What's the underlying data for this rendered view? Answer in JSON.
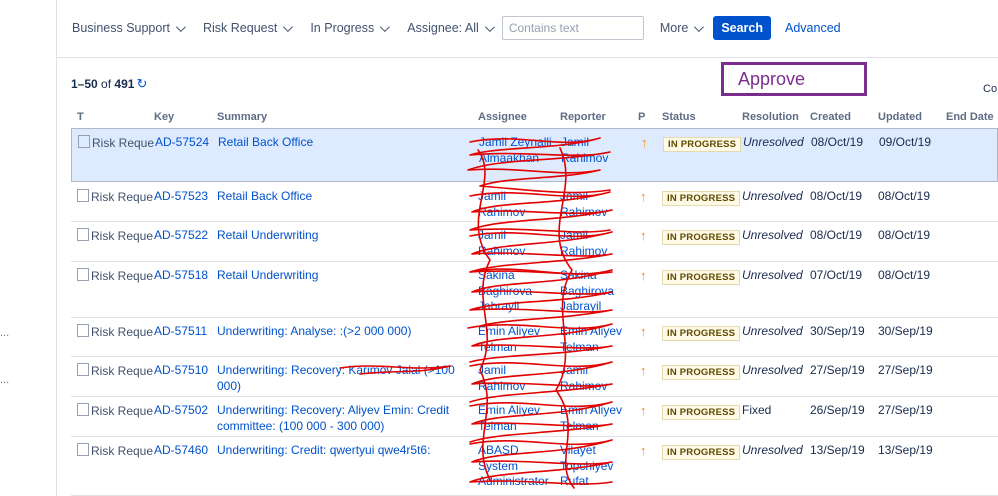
{
  "filters": {
    "project": "Business Support",
    "type": "Risk Request",
    "status": "In Progress",
    "assignee": "Assignee: All",
    "text_placeholder": "Contains text",
    "more": "More",
    "search": "Search",
    "advanced": "Advanced"
  },
  "results": {
    "range": "1–50",
    "of": "of",
    "total": "491"
  },
  "annotation": {
    "approve": "Approve"
  },
  "cut_text": "Co",
  "rail": {
    "dots1": "...",
    "dots2": "..."
  },
  "columns": [
    "T",
    "Key",
    "Summary",
    "Assignee",
    "Reporter",
    "P",
    "Status",
    "Resolution",
    "Created",
    "Updated",
    "End Date"
  ],
  "rows": [
    {
      "type_alt": "Risk Reque",
      "key": "AD-57524",
      "summary": "Retail Back Office",
      "assignee": "Jamil Zeynalli Almaakhan",
      "reporter": "Jamil Rahimov",
      "priority": "↑",
      "status": "IN PROGRESS",
      "resolution": "Unresolved",
      "created": "08/Oct/19",
      "updated": "09/Oct/19"
    },
    {
      "type_alt": "Risk Reque",
      "key": "AD-57523",
      "summary": "Retail Back Office",
      "assignee": "Jamil Rahimov",
      "reporter": "Jamil Rahimov",
      "priority": "↑",
      "status": "IN PROGRESS",
      "resolution": "Unresolved",
      "created": "08/Oct/19",
      "updated": "08/Oct/19"
    },
    {
      "type_alt": "Risk Reque",
      "key": "AD-57522",
      "summary": "Retail Underwriting",
      "assignee": "Jamil Rahimov",
      "reporter": "Jamil Rahimov",
      "priority": "↑",
      "status": "IN PROGRESS",
      "resolution": "Unresolved",
      "created": "08/Oct/19",
      "updated": "08/Oct/19"
    },
    {
      "type_alt": "Risk Reque",
      "key": "AD-57518",
      "summary": "Retail Underwriting",
      "assignee": "Sakina Baghirova Jabrayil",
      "reporter": "Sakina Baghirova Jabrayil",
      "priority": "↑",
      "status": "IN PROGRESS",
      "resolution": "Unresolved",
      "created": "07/Oct/19",
      "updated": "08/Oct/19"
    },
    {
      "type_alt": "Risk Reque",
      "key": "AD-57511",
      "summary": "Underwriting: Analyse: :(>2 000 000)",
      "assignee": "Emin Aliyev Telman",
      "reporter": "Emin Aliyev Telman",
      "priority": "↑",
      "status": "IN PROGRESS",
      "resolution": "Unresolved",
      "created": "30/Sep/19",
      "updated": "30/Sep/19"
    },
    {
      "type_alt": "Risk Reque",
      "key": "AD-57510",
      "summary": "Underwriting: Recovery: Karimov Jalal (>100 000)",
      "assignee": "Jamil Rahimov",
      "reporter": "Jamil Rahimov",
      "priority": "↑",
      "status": "IN PROGRESS",
      "resolution": "Unresolved",
      "created": "27/Sep/19",
      "updated": "27/Sep/19"
    },
    {
      "type_alt": "Risk Reque",
      "key": "AD-57502",
      "summary": "Underwriting: Recovery: Aliyev Emin: Credit committee: (100 000 - 300 000)",
      "assignee": "Emin Aliyev Telman",
      "reporter": "Emin Aliyev Telman",
      "priority": "↑",
      "status": "IN PROGRESS",
      "resolution": "Fixed",
      "created": "26/Sep/19",
      "updated": "27/Sep/19"
    },
    {
      "type_alt": "Risk Reque",
      "key": "AD-57460",
      "summary": "Underwriting: Credit: qwertyui qwe4r5t6:",
      "assignee": "ABASD System Administrator",
      "reporter": "Vilayet Topchiyev Rufat",
      "priority": "↑",
      "status": "IN PROGRESS",
      "resolution": "Unresolved",
      "created": "13/Sep/19",
      "updated": "13/Sep/19"
    }
  ],
  "colors": {
    "accent": "#0052cc",
    "scribble": "#e30000",
    "highlight": "#deebff",
    "annotation": "#7b2d8f",
    "priority": "#ff8b00"
  }
}
